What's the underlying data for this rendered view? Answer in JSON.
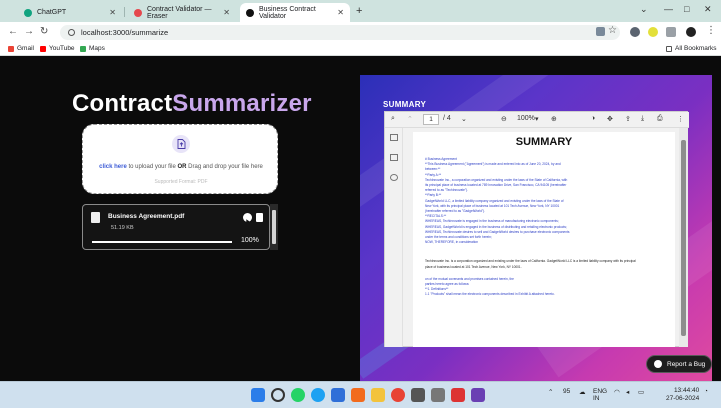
{
  "browser": {
    "tabs": [
      {
        "label": "ChatGPT",
        "active": false,
        "favicon_color": "#10a37f"
      },
      {
        "label": "Contract Validator — Eraser",
        "active": false,
        "favicon_color": "#e5484d"
      },
      {
        "label": "Business Contract Validator",
        "active": true,
        "favicon_color": "#111111"
      }
    ],
    "new_tab_symbol": "+",
    "window_controls": [
      "⌄",
      "—",
      "□",
      "✕"
    ],
    "url": "localhost:3000/summarize",
    "bookmarks": [
      {
        "label": "Gmail",
        "color": "#ea4335"
      },
      {
        "label": "YouTube",
        "color": "#ff0000"
      },
      {
        "label": "Maps",
        "color": "#34a853"
      }
    ],
    "all_bookmarks_label": "All Bookmarks"
  },
  "app": {
    "title_part1": "Contract",
    "title_part2": "Summarizer",
    "accent_color": "#c9a7ec"
  },
  "upload": {
    "link_text": "click here",
    "text_mid": " to upload your file ",
    "or_text": "OR",
    "text_end": " Drag and drop your file here",
    "formats": "Supported Format: PDF"
  },
  "file": {
    "name": "Business Agreement.pdf",
    "size": "51.19 KB",
    "progress_percent": 100,
    "progress_label": "100%"
  },
  "summary": {
    "label": "SUMMARY",
    "viewer": {
      "page_current": "1",
      "page_total": "/ 4",
      "zoom": "100%",
      "zoom_caret": "▾"
    },
    "document_title": "SUMMARY",
    "lines_blue": [
      "# Business Agreement",
      "**This Business Agreement (\"Agreement\") is made and entered into as of June 20, 2024, by and",
      "between:**",
      "**Party A:**",
      "TechInnovate Inc., a corporation organized and existing under the laws of the State of California, with",
      "its principal place of business located at 789 Innovation Drive, San Francisco, CA 94105 (hereinafter",
      "referred to as \"TechInnovate\").",
      "**Party B:**",
      "GadgetWorld LLC, a limited liability company organized and existing under the laws of the State of",
      "New York, with its principal place of business located at 101 Tech Avenue, New York, NY 10001",
      "(hereinafter referred to as \"GadgetWorld\").",
      "**RECITALS:**",
      "WHEREAS, TechInnovate is engaged in the business of manufacturing electronic components;",
      "WHEREAS, GadgetWorld is engaged in the business of distributing and retailing electronic products;",
      "WHEREAS, TechInnovate desires to sell and GadgetWorld desires to purchase electronic components",
      "under the terms and conditions set forth herein;",
      "NOW, THEREFORE, in consideration"
    ],
    "lines_dark": [
      "TechInnovate Inc. is a corporation organized and existing under the laws of California. GadgetWorld LLC is a limited liability company with its principal",
      "place of business located at 101 Tech Avenue, New York, NY 10001."
    ],
    "lines_tail": [
      "on of the mutual covenants and promises contained herein, the",
      "parties hereto agree as follows:",
      "**1. Definitions**",
      "1.1 \"Products\" shall mean the electronic components described in Exhibit A attached hereto."
    ]
  },
  "report_bug_label": "Report a Bug",
  "taskbar": {
    "weather": "95",
    "lang_line1": "ENG",
    "lang_line2": "IN",
    "time": "13:44:40",
    "date": "27-06-2024"
  }
}
